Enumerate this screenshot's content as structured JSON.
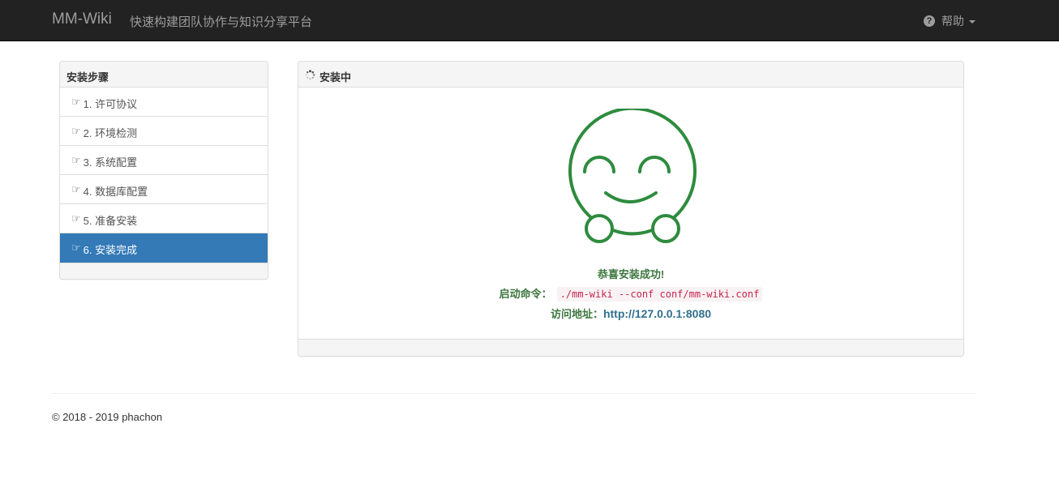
{
  "navbar": {
    "brand": "MM-Wiki",
    "tagline": "快速构建团队协作与知识分享平台",
    "help_label": "帮助",
    "help_icon": "question-circle-icon"
  },
  "steps": {
    "title": "安装步骤",
    "items": [
      {
        "label": "1. 许可协议",
        "active": false
      },
      {
        "label": "2. 环境检测",
        "active": false
      },
      {
        "label": "3. 系统配置",
        "active": false
      },
      {
        "label": "4. 数据库配置",
        "active": false
      },
      {
        "label": "5. 准备安装",
        "active": false
      },
      {
        "label": "6. 安装完成",
        "active": true
      }
    ],
    "item_icon": "hand-pointer-icon",
    "hand_glyph": "☞",
    "active_color": "#337ab7"
  },
  "main": {
    "title": "安装中",
    "success_message": "恭喜安装成功!",
    "command_label": "启动命令：",
    "command": "./mm-wiki --conf conf/mm-wiki.conf",
    "url_label": "访问地址：",
    "url": "http://127.0.0.1:8080",
    "smiley_color": "#2e8b3e"
  },
  "footer": {
    "copyright": "© 2018 - 2019 phachon"
  }
}
